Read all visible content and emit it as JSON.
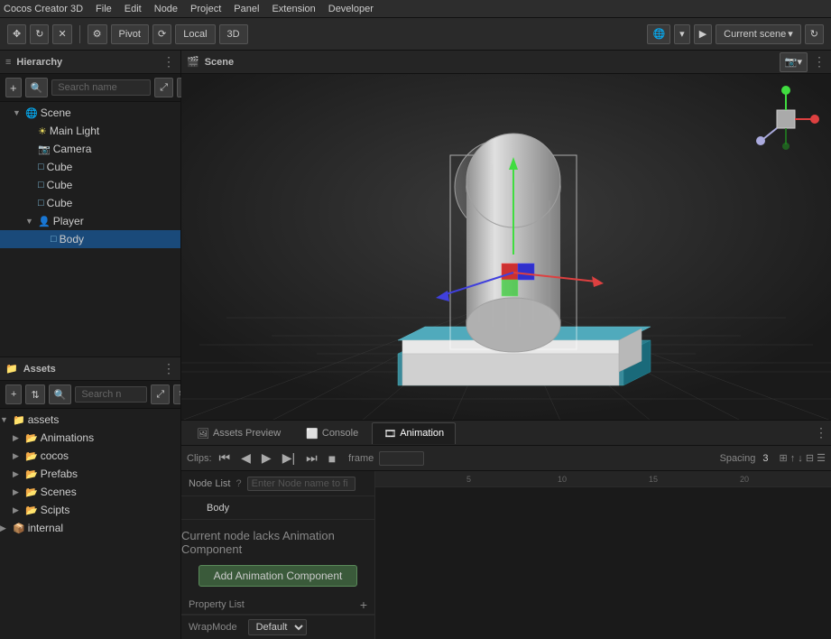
{
  "menubar": {
    "items": [
      "Cocos Creator 3D",
      "File",
      "Edit",
      "Node",
      "Project",
      "Panel",
      "Extension",
      "Developer"
    ]
  },
  "toolbar": {
    "move_icon": "✥",
    "refresh_icon": "↻",
    "close_icon": "✕",
    "pivot_label": "Pivot",
    "local_label": "Local",
    "3d_label": "3D",
    "play_icon": "▶",
    "current_scene_label": "Current scene",
    "dropdown_icon": "▾",
    "refresh2_icon": "↻",
    "globe_icon": "🌐",
    "settings_icon": "⚙"
  },
  "hierarchy": {
    "title": "Hierarchy",
    "search_placeholder": "Search name",
    "items": [
      {
        "label": "Scene",
        "indent": 0,
        "icon": "🌐",
        "expanded": true,
        "type": "scene"
      },
      {
        "label": "Main Light",
        "indent": 1,
        "icon": "☀",
        "type": "light"
      },
      {
        "label": "Camera",
        "indent": 1,
        "icon": "📷",
        "type": "camera"
      },
      {
        "label": "Cube",
        "indent": 1,
        "icon": "□",
        "type": "cube"
      },
      {
        "label": "Cube",
        "indent": 1,
        "icon": "□",
        "type": "cube"
      },
      {
        "label": "Cube",
        "indent": 1,
        "icon": "□",
        "type": "cube"
      },
      {
        "label": "Player",
        "indent": 1,
        "icon": "👤",
        "expanded": true,
        "type": "player"
      },
      {
        "label": "Body",
        "indent": 2,
        "icon": "□",
        "type": "body",
        "selected": true
      }
    ]
  },
  "assets": {
    "title": "Assets",
    "search_placeholder": "Search n",
    "items": [
      {
        "label": "assets",
        "indent": 0,
        "icon": "📁",
        "expanded": true,
        "type": "folder"
      },
      {
        "label": "Animations",
        "indent": 1,
        "icon": "📂",
        "type": "folder"
      },
      {
        "label": "cocos",
        "indent": 1,
        "icon": "📂",
        "type": "folder"
      },
      {
        "label": "Prefabs",
        "indent": 1,
        "icon": "📂",
        "type": "folder"
      },
      {
        "label": "Scenes",
        "indent": 1,
        "icon": "📂",
        "type": "folder"
      },
      {
        "label": "Scipts",
        "indent": 1,
        "icon": "📂",
        "type": "folder"
      },
      {
        "label": "internal",
        "indent": 0,
        "icon": "📦",
        "type": "internal"
      }
    ]
  },
  "scene": {
    "title": "Scene"
  },
  "bottom_tabs": [
    {
      "label": "Assets Preview",
      "active": false
    },
    {
      "label": "Console",
      "active": false
    },
    {
      "label": "Animation",
      "active": true
    }
  ],
  "animation": {
    "clips_label": "Clips:",
    "node_list_label": "Node List",
    "node_list_placeholder": "Enter Node name to fi",
    "body_node": "Body",
    "notice": "Current node lacks Animation Component",
    "add_btn": "Add Animation Component",
    "property_list_label": "Property List",
    "wrapmode_label": "WrapMode",
    "wrapmode_value": "Default",
    "frame_label": "frame",
    "spacing_label": "Spacing",
    "spacing_value": "3",
    "ruler_marks": [
      "5",
      "10",
      "15",
      "20"
    ]
  }
}
